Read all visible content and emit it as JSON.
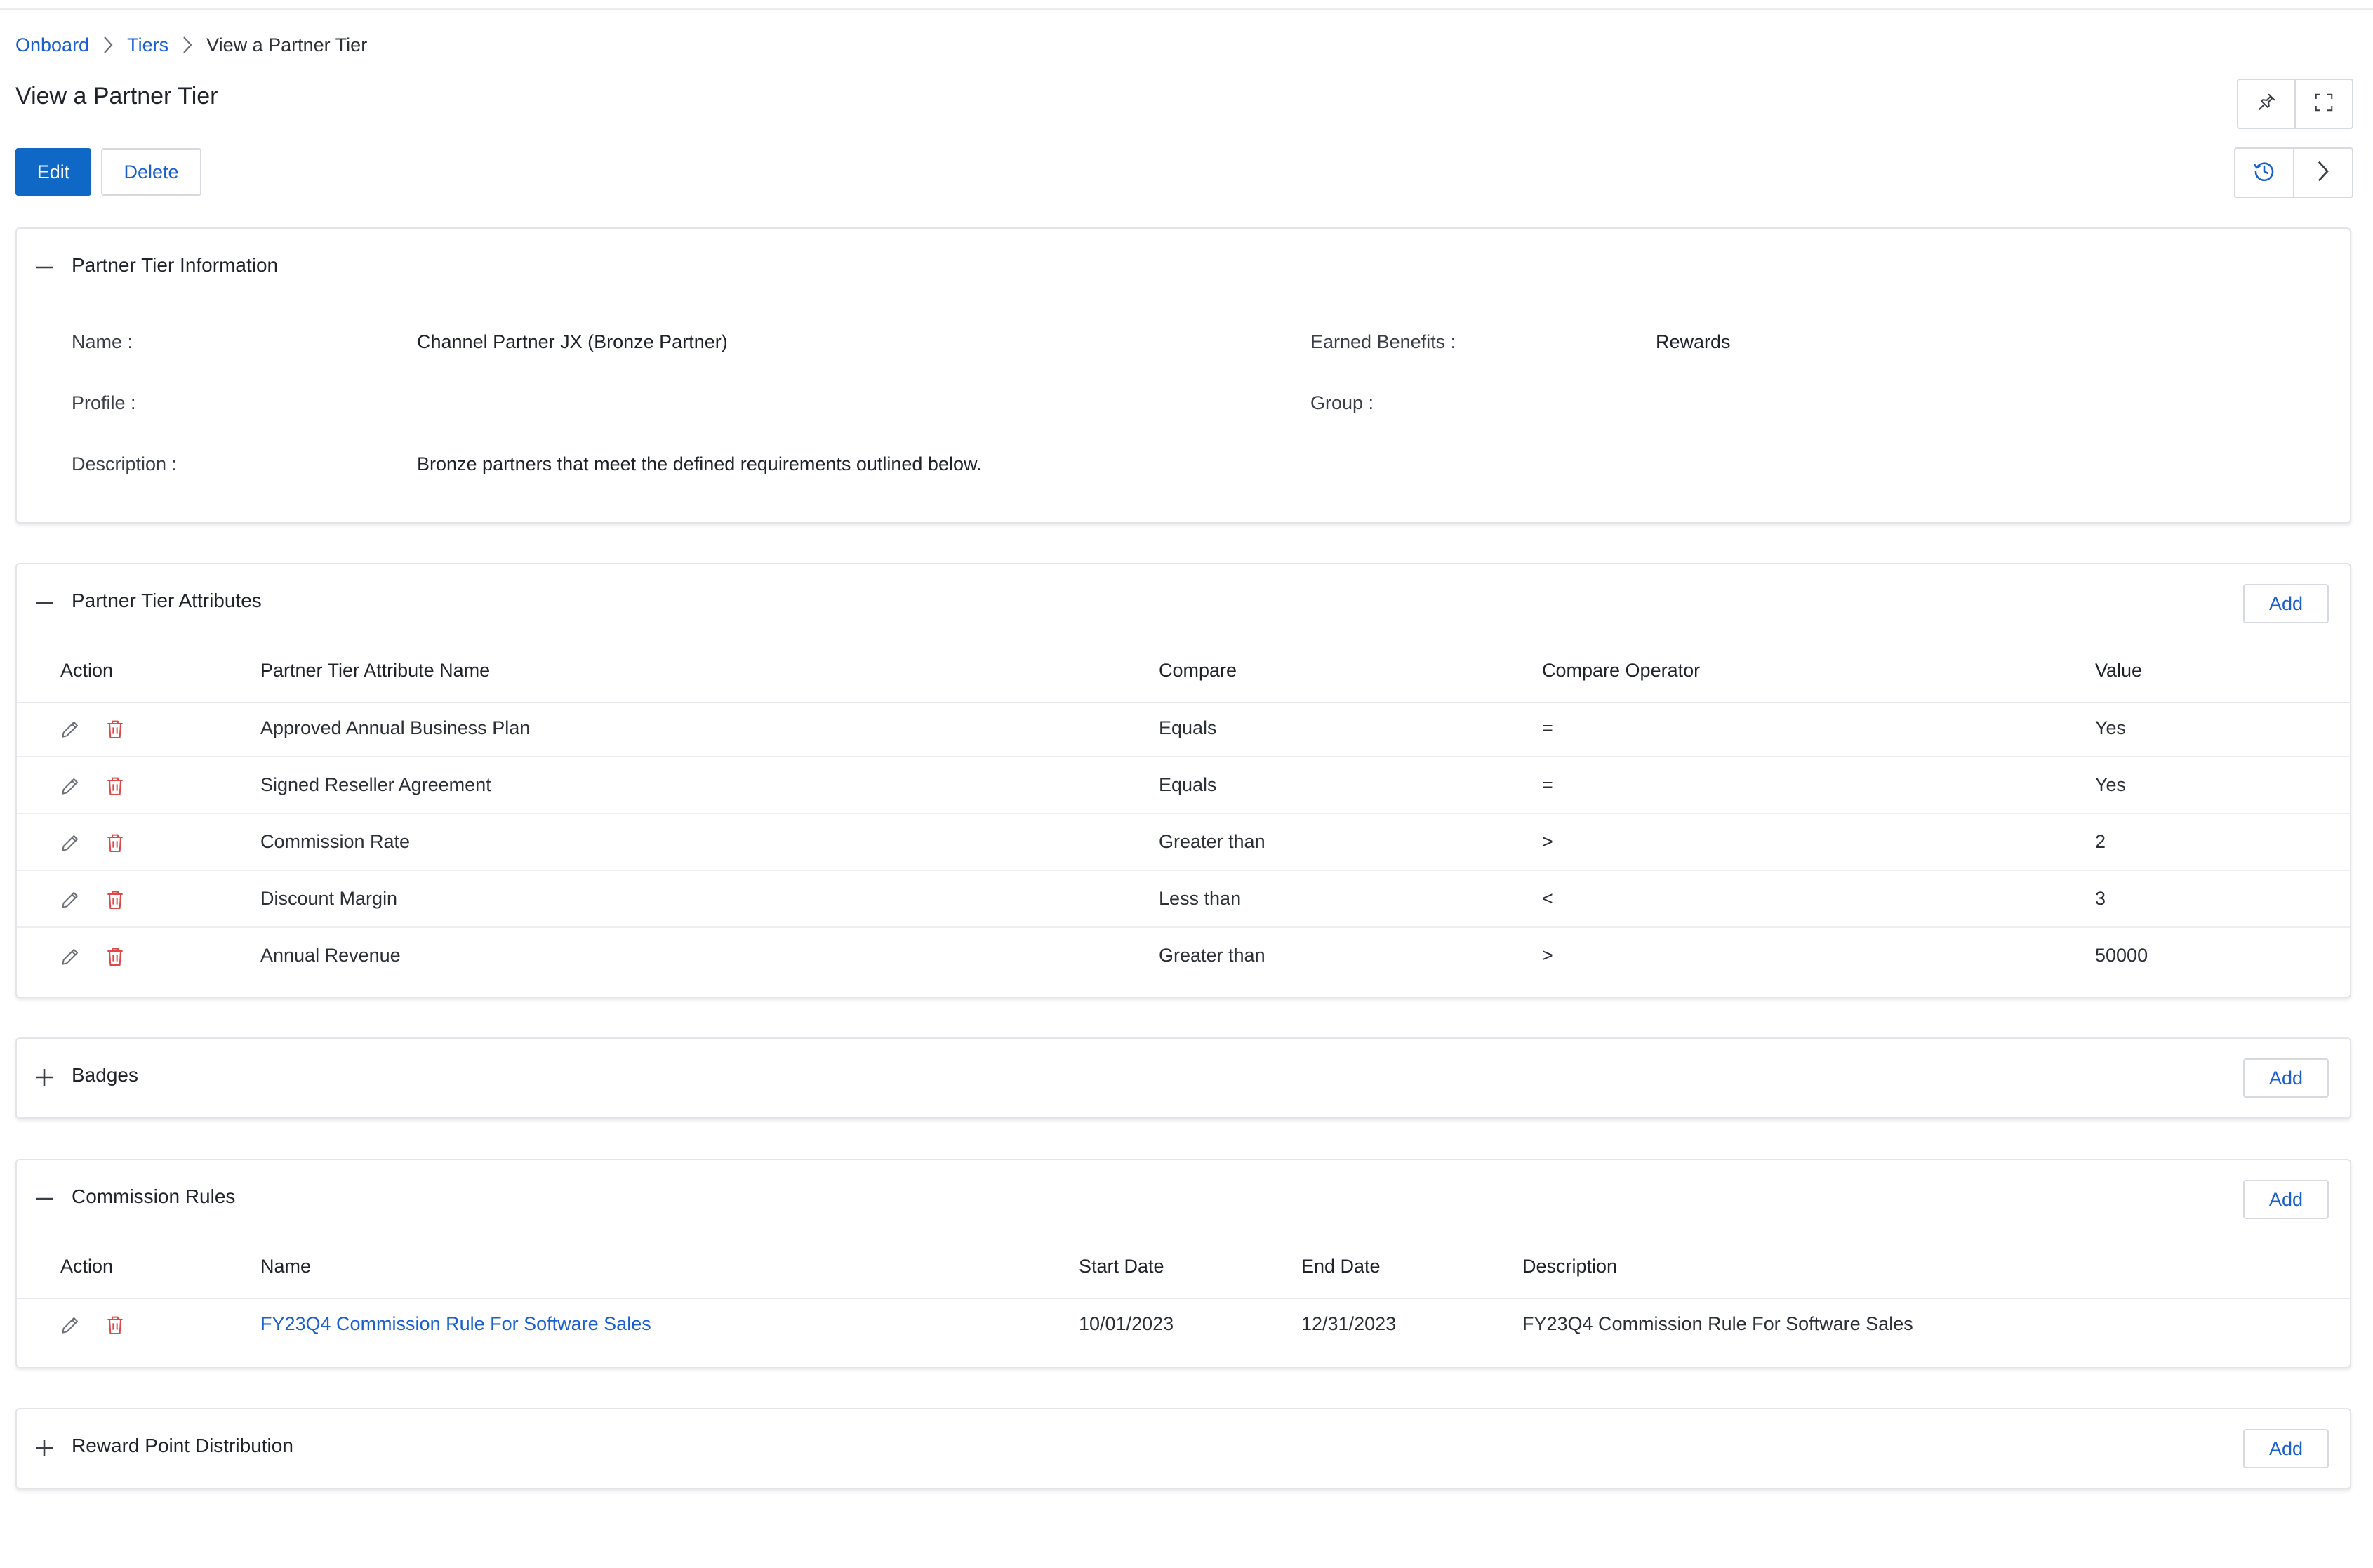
{
  "breadcrumb": {
    "items": [
      {
        "label": "Onboard"
      },
      {
        "label": "Tiers"
      },
      {
        "label": "View a Partner Tier"
      }
    ]
  },
  "page": {
    "title": "View a Partner Tier"
  },
  "toolbar": {
    "edit_label": "Edit",
    "delete_label": "Delete"
  },
  "icons": {
    "pin": "pin-icon",
    "fullscreen": "fullscreen-icon",
    "history": "history-icon",
    "next": "chevron-right-icon"
  },
  "colors": {
    "primary": "#0f67c6",
    "link": "#1a5fd0",
    "danger": "#e04848"
  },
  "partner_tier_information": {
    "title": "Partner Tier Information",
    "fields": {
      "name": {
        "label": "Name :",
        "value": "Channel Partner JX (Bronze Partner)"
      },
      "earned_benefits": {
        "label": "Earned Benefits :",
        "value": "Rewards"
      },
      "profile": {
        "label": "Profile :",
        "value": ""
      },
      "group": {
        "label": "Group :",
        "value": ""
      },
      "description": {
        "label": "Description :",
        "value": "Bronze partners that meet the defined requirements outlined below."
      }
    }
  },
  "partner_tier_attributes": {
    "title": "Partner Tier Attributes",
    "add_label": "Add",
    "columns": [
      "Action",
      "Partner Tier Attribute Name",
      "Compare",
      "Compare Operator",
      "Value"
    ],
    "rows": [
      {
        "name": "Approved Annual Business Plan",
        "compare": "Equals",
        "operator": "=",
        "value": "Yes"
      },
      {
        "name": "Signed Reseller Agreement",
        "compare": "Equals",
        "operator": "=",
        "value": "Yes"
      },
      {
        "name": "Commission Rate",
        "compare": "Greater than",
        "operator": ">",
        "value": "2"
      },
      {
        "name": "Discount Margin",
        "compare": "Less than",
        "operator": "<",
        "value": "3"
      },
      {
        "name": "Annual Revenue",
        "compare": "Greater than",
        "operator": ">",
        "value": "50000"
      }
    ]
  },
  "badges": {
    "title": "Badges",
    "add_label": "Add"
  },
  "commission_rules": {
    "title": "Commission Rules",
    "add_label": "Add",
    "columns": [
      "Action",
      "Name",
      "Start Date",
      "End Date",
      "Description"
    ],
    "rows": [
      {
        "name": "FY23Q4 Commission Rule For Software Sales",
        "start_date": "10/01/2023",
        "end_date": "12/31/2023",
        "description": "FY23Q4 Commission Rule For Software Sales"
      }
    ]
  },
  "reward_point_distribution": {
    "title": "Reward Point Distribution",
    "add_label": "Add"
  }
}
